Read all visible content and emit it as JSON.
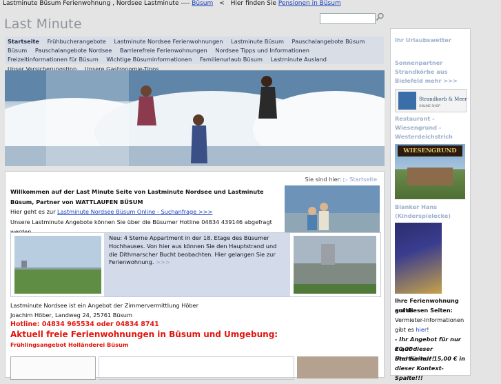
{
  "top_bar": {
    "text_before": "Lastminute Büsum Ferienwohnung , Nordsee Lastminute ----",
    "link1": "Büsum",
    "separator": "<",
    "text_mid": "Hier finden Sie",
    "link2": "Pensionen in Büsum"
  },
  "site_title": "Last Minute",
  "search": {
    "placeholder": ""
  },
  "nav": {
    "items": [
      "Startseite",
      "Frühbucherangebote",
      "Lastminute Nordsee Ferienwohnungen",
      "Lastminute Büsum",
      "Pauschalangebote Büsum",
      "Büsum",
      "Pauschalangebote Nordsee",
      "Barrierefreie Ferienwohnungen",
      "Nordsee Tipps und Informationen",
      "Freizeitinformationen für Büsum",
      "Wichtige Büsuminformationen",
      "Familienurlaub Büsum",
      "Lastminute Ausland",
      "Unser Versicherungstipp",
      "Unsere Gastronomie-Tipps"
    ]
  },
  "breadcrumb": {
    "prefix": "Sie sind hier:",
    "current": "Startseite"
  },
  "intro": {
    "heading": "Willkommen auf der Last Minute Seite von Lastminute Nordsee und Lastminute Büsum, Partner von WATTLAUFEN BÜSUM",
    "line1_prefix": "Hier geht es zur",
    "line1_link": "Lastminute Nordsee Büsum Online - Suchanfrage >>>",
    "line2": "Unsere Lastminute Angebote können Sie über die Büsumer Hotline 04834 439146 abgefragt werden."
  },
  "feature": {
    "text": "Neu: 4 Sterne Appartment in der 18. Etage des Büsumer Hochhauses. Von hier aus können Sie den Hauptstrand und die Dithmarscher Bucht beobachten. Hier gelangen Sie zur Ferienwohnung.",
    "more": ">>>"
  },
  "contact": {
    "line1": "Lastminute Nordsee ist ein Angebot der Zimmervermittlung Höber",
    "line2": "Joachim Höber, Landweg 24, 25761 Büsum",
    "hotline": "Hotline: 04834 965534 oder 04834 8741",
    "headline": "Aktuell freie Ferienwohnungen in Büsum und Umgebung:",
    "offer": "Frühlingsangebot Holländerei Büsum"
  },
  "sidebar": {
    "weather": "Ihr Urlaubswetter",
    "sponsor_line1": "Sonnenpartner",
    "sponsor_line2": "Strandkörbe aus",
    "sponsor_line3": "Bielefeld mehr >>>",
    "strandkorb_logo": "Strandkorb & Meer",
    "strandkorb_sub": "ONLINE SHOP",
    "restaurant_line1": "Restaurant -",
    "restaurant_line2": "Wiesengrund -",
    "restaurant_line3": "Westerdeichstrich",
    "wiesengrund_sign": "WIESENGRUND",
    "blanker_line1": "Blanker Hans",
    "blanker_line2": "(Kinderspielecke)",
    "promo_line1": "Ihre Ferienwohnung gratis",
    "promo_line2": "auf diesen Seiten:",
    "promo_line3": "Vermieter-Informationen",
    "promo_line4_prefix": "gibt es",
    "promo_line4_link": "hier",
    "promo_line4_suffix": "!",
    "promo_line5": "- Ihr Angebot für nur 20,00",
    "promo_line6": "€ auf dieser Startseite!!!",
    "promo_line7": "Und für nur 15,00 € in",
    "promo_line8": "dieser Kontext-Spalte!!!"
  },
  "colors": {
    "accent_blue": "#1a3fbd",
    "hotline_red": "#e2140c",
    "nav_bg": "#d9dde6",
    "sidebar_heading": "#9db0cd"
  }
}
